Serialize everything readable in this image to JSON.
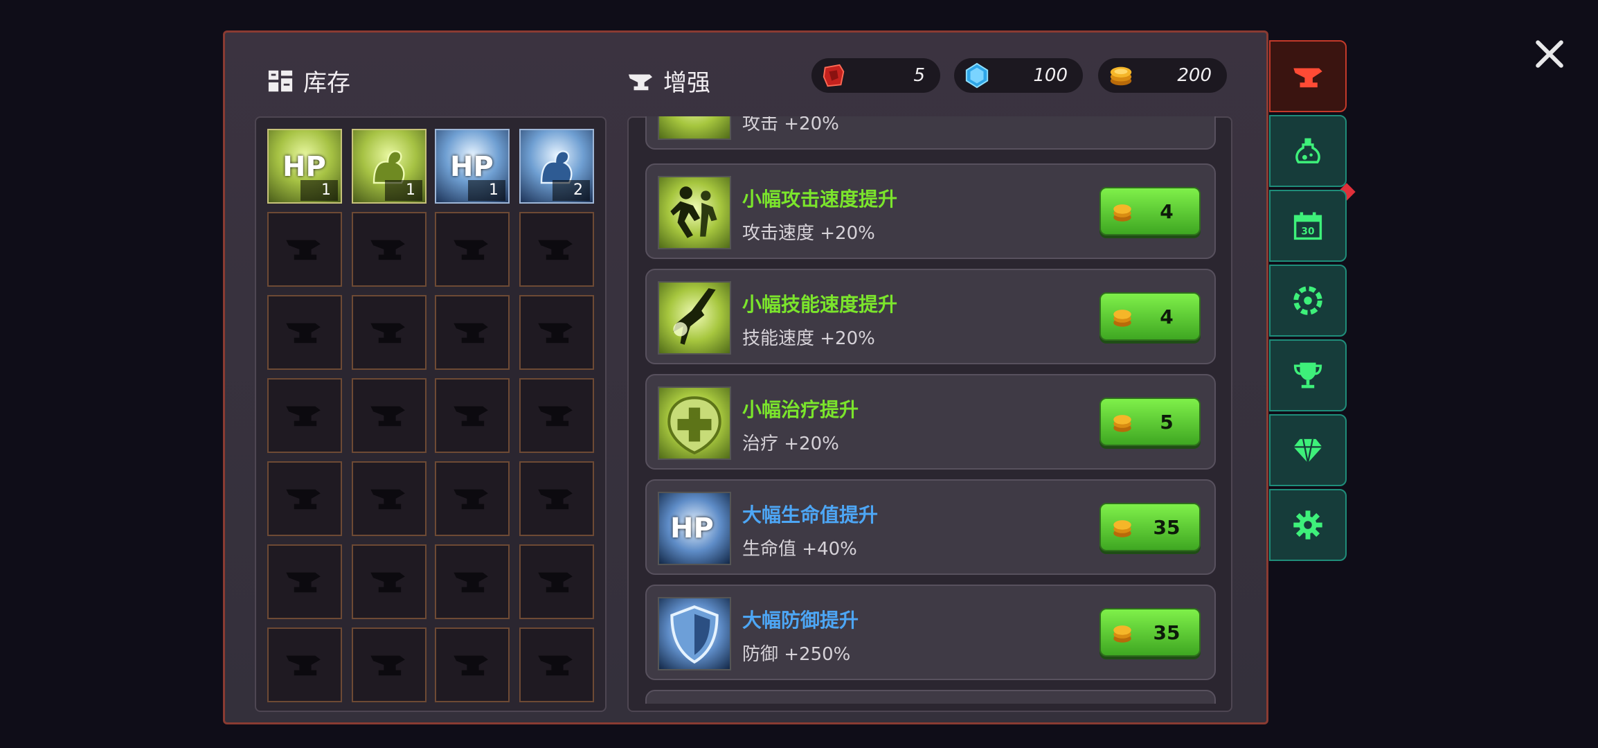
{
  "inventory_title": "库存",
  "enhance_title": "增强",
  "currency": {
    "red_gem": "5",
    "blue_gem": "100",
    "gold": "200"
  },
  "inventory_items": [
    {
      "type": "hp",
      "color": "green",
      "count": "1"
    },
    {
      "type": "arm",
      "color": "green",
      "count": "1"
    },
    {
      "type": "hp",
      "color": "blue",
      "count": "1"
    },
    {
      "type": "arm",
      "color": "blue",
      "count": "2"
    }
  ],
  "partial_top_row": {
    "desc": "攻击 +20%"
  },
  "upgrades": [
    {
      "title": "小幅攻击速度提升",
      "desc": "攻击速度 +20%",
      "price": "4",
      "color": "green",
      "title_color": "#7be52c"
    },
    {
      "title": "小幅技能速度提升",
      "desc": "技能速度 +20%",
      "price": "4",
      "color": "green",
      "title_color": "#7be52c"
    },
    {
      "title": "小幅治疗提升",
      "desc": "治疗 +20%",
      "price": "5",
      "color": "green",
      "title_color": "#7be52c"
    },
    {
      "title": "大幅生命值提升",
      "desc": "生命值 +40%",
      "price": "35",
      "color": "blue",
      "title_color": "#4da6f5"
    },
    {
      "title": "大幅防御提升",
      "desc": "防御 +250%",
      "price": "35",
      "color": "blue",
      "title_color": "#4da6f5"
    }
  ],
  "side_tabs": [
    "anvil-icon",
    "potion-icon",
    "calendar-icon",
    "wheel-icon",
    "trophy-icon",
    "diamond-icon",
    "gear-icon"
  ],
  "calendar_number": "30",
  "colors": {
    "accent_green": "#7be52c",
    "accent_blue": "#4da6f5",
    "panel_border": "#8a3b32"
  }
}
